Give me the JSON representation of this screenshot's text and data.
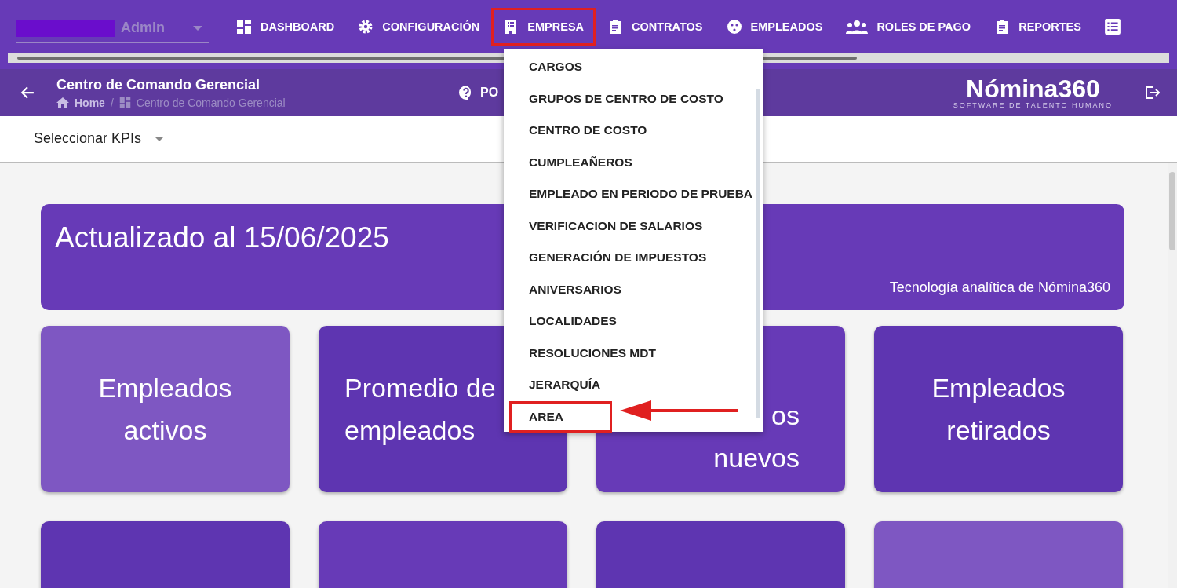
{
  "user": {
    "role": "Admin"
  },
  "nav": [
    {
      "label": "DASHBOARD",
      "highlighted": false
    },
    {
      "label": "CONFIGURACIÓN",
      "highlighted": false
    },
    {
      "label": "EMPRESA",
      "highlighted": true
    },
    {
      "label": "CONTRATOS",
      "highlighted": false
    },
    {
      "label": "EMPLEADOS",
      "highlighted": false
    },
    {
      "label": "ROLES DE PAGO",
      "highlighted": false
    },
    {
      "label": "REPORTES",
      "highlighted": false
    }
  ],
  "header": {
    "title": "Centro de Comando Gerencial",
    "breadcrumb": [
      "Home",
      "Centro de Comando Gerencial"
    ],
    "separator": "/",
    "help": "PO",
    "brand": "Nómina360",
    "tagline": "SOFTWARE DE TALENTO HUMANO"
  },
  "kpi_select": {
    "placeholder": "Seleccionar KPIs"
  },
  "banner": {
    "title": "Actualizado al 15/06/2025",
    "footer": "Tecnología analítica de Nómina360"
  },
  "cards": [
    {
      "lines": [
        "Empleados",
        "activos"
      ],
      "color": "#7e57c2"
    },
    {
      "lines": [
        "Promedio de",
        "empleados"
      ],
      "color": "#5e35b1"
    },
    {
      "lines": [
        "os",
        "nuevos"
      ],
      "color": "#673ab7"
    },
    {
      "lines": [
        "Empleados",
        "retirados"
      ],
      "color": "#5e35b1"
    },
    {
      "color": "#5e35b1"
    },
    {
      "color": "#673ab7"
    },
    {
      "color": "#5e35b1"
    },
    {
      "color": "#7e57c2"
    }
  ],
  "menu": {
    "items": [
      {
        "label": "CARGOS",
        "highlighted": false
      },
      {
        "label": "GRUPOS DE CENTRO DE COSTO",
        "highlighted": false
      },
      {
        "label": "CENTRO DE COSTO",
        "highlighted": false
      },
      {
        "label": "CUMPLEAÑEROS",
        "highlighted": false
      },
      {
        "label": "EMPLEADO EN PERIODO DE PRUEBA",
        "highlighted": false
      },
      {
        "label": "VERIFICACION DE SALARIOS",
        "highlighted": false
      },
      {
        "label": "GENERACIÓN DE IMPUESTOS",
        "highlighted": false
      },
      {
        "label": "ANIVERSARIOS",
        "highlighted": false
      },
      {
        "label": "LOCALIDADES",
        "highlighted": false
      },
      {
        "label": "RESOLUCIONES MDT",
        "highlighted": false
      },
      {
        "label": "JERARQUÍA",
        "highlighted": false
      },
      {
        "label": "AREA",
        "highlighted": true
      }
    ]
  }
}
